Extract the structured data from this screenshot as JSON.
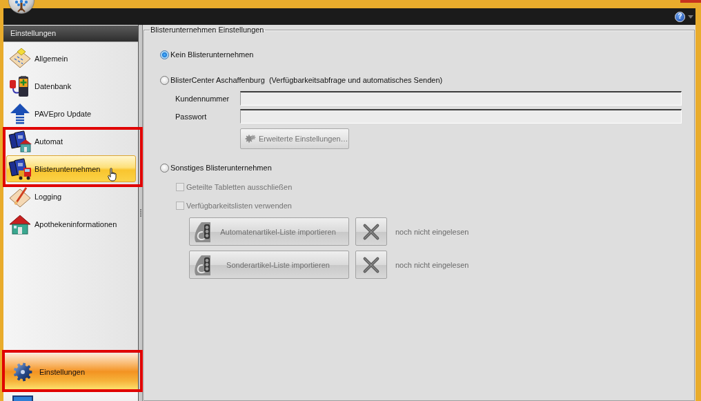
{
  "toolbar": {
    "help": "?"
  },
  "sidebar": {
    "title": "Einstellungen",
    "items": [
      {
        "label": "Allgemein",
        "selected": false,
        "highlighted": false,
        "hovered": false
      },
      {
        "label": "Datenbank",
        "selected": false,
        "highlighted": false,
        "hovered": false
      },
      {
        "label": "PAVEpro Update",
        "selected": false,
        "highlighted": false,
        "hovered": false
      },
      {
        "label": "Automat",
        "selected": false,
        "highlighted": true,
        "hovered": false
      },
      {
        "label": "Blisterunternehmen",
        "selected": true,
        "highlighted": true,
        "hovered": true
      },
      {
        "label": "Logging",
        "selected": false,
        "highlighted": false,
        "hovered": false
      },
      {
        "label": "Apothekeninformationen",
        "selected": false,
        "highlighted": false,
        "hovered": false
      }
    ]
  },
  "nav_buttons": [
    {
      "label": "Einstellungen",
      "selected": true,
      "highlighted": true
    },
    {
      "selected": false,
      "highlighted": false
    }
  ],
  "settings_group": {
    "title": "Blisterunternehmen Einstellungen",
    "options": [
      {
        "kind": "radio",
        "label": "Kein Blisterunternehmen",
        "selected": true
      },
      {
        "kind": "radio",
        "label": "BlisterCenter Aschaffenburg  (Verfügbarkeitsabfrage und automatisches Senden)",
        "selected": false,
        "fields": [
          {
            "label": "Kundennummer"
          },
          {
            "label": "Passwort"
          }
        ],
        "button": {
          "label": "Erweiterte Einstellungen…",
          "disabled": true
        }
      },
      {
        "kind": "radio",
        "label": "Sonstiges Blisterunternehmen",
        "selected": false,
        "checkboxes": [
          {
            "label": "Geteilte Tabletten ausschließen",
            "checked": false,
            "disabled": true
          },
          {
            "label": "Verfügbarkeitslisten verwenden",
            "checked": false,
            "disabled": true
          }
        ],
        "imports": [
          {
            "label": "Automatenartikel-Liste importieren",
            "status": "noch nicht eingelesen",
            "disabled": true
          },
          {
            "label": "Sonderartikel-Liste importieren",
            "status": "noch nicht eingelesen",
            "disabled": true
          }
        ]
      }
    ]
  }
}
